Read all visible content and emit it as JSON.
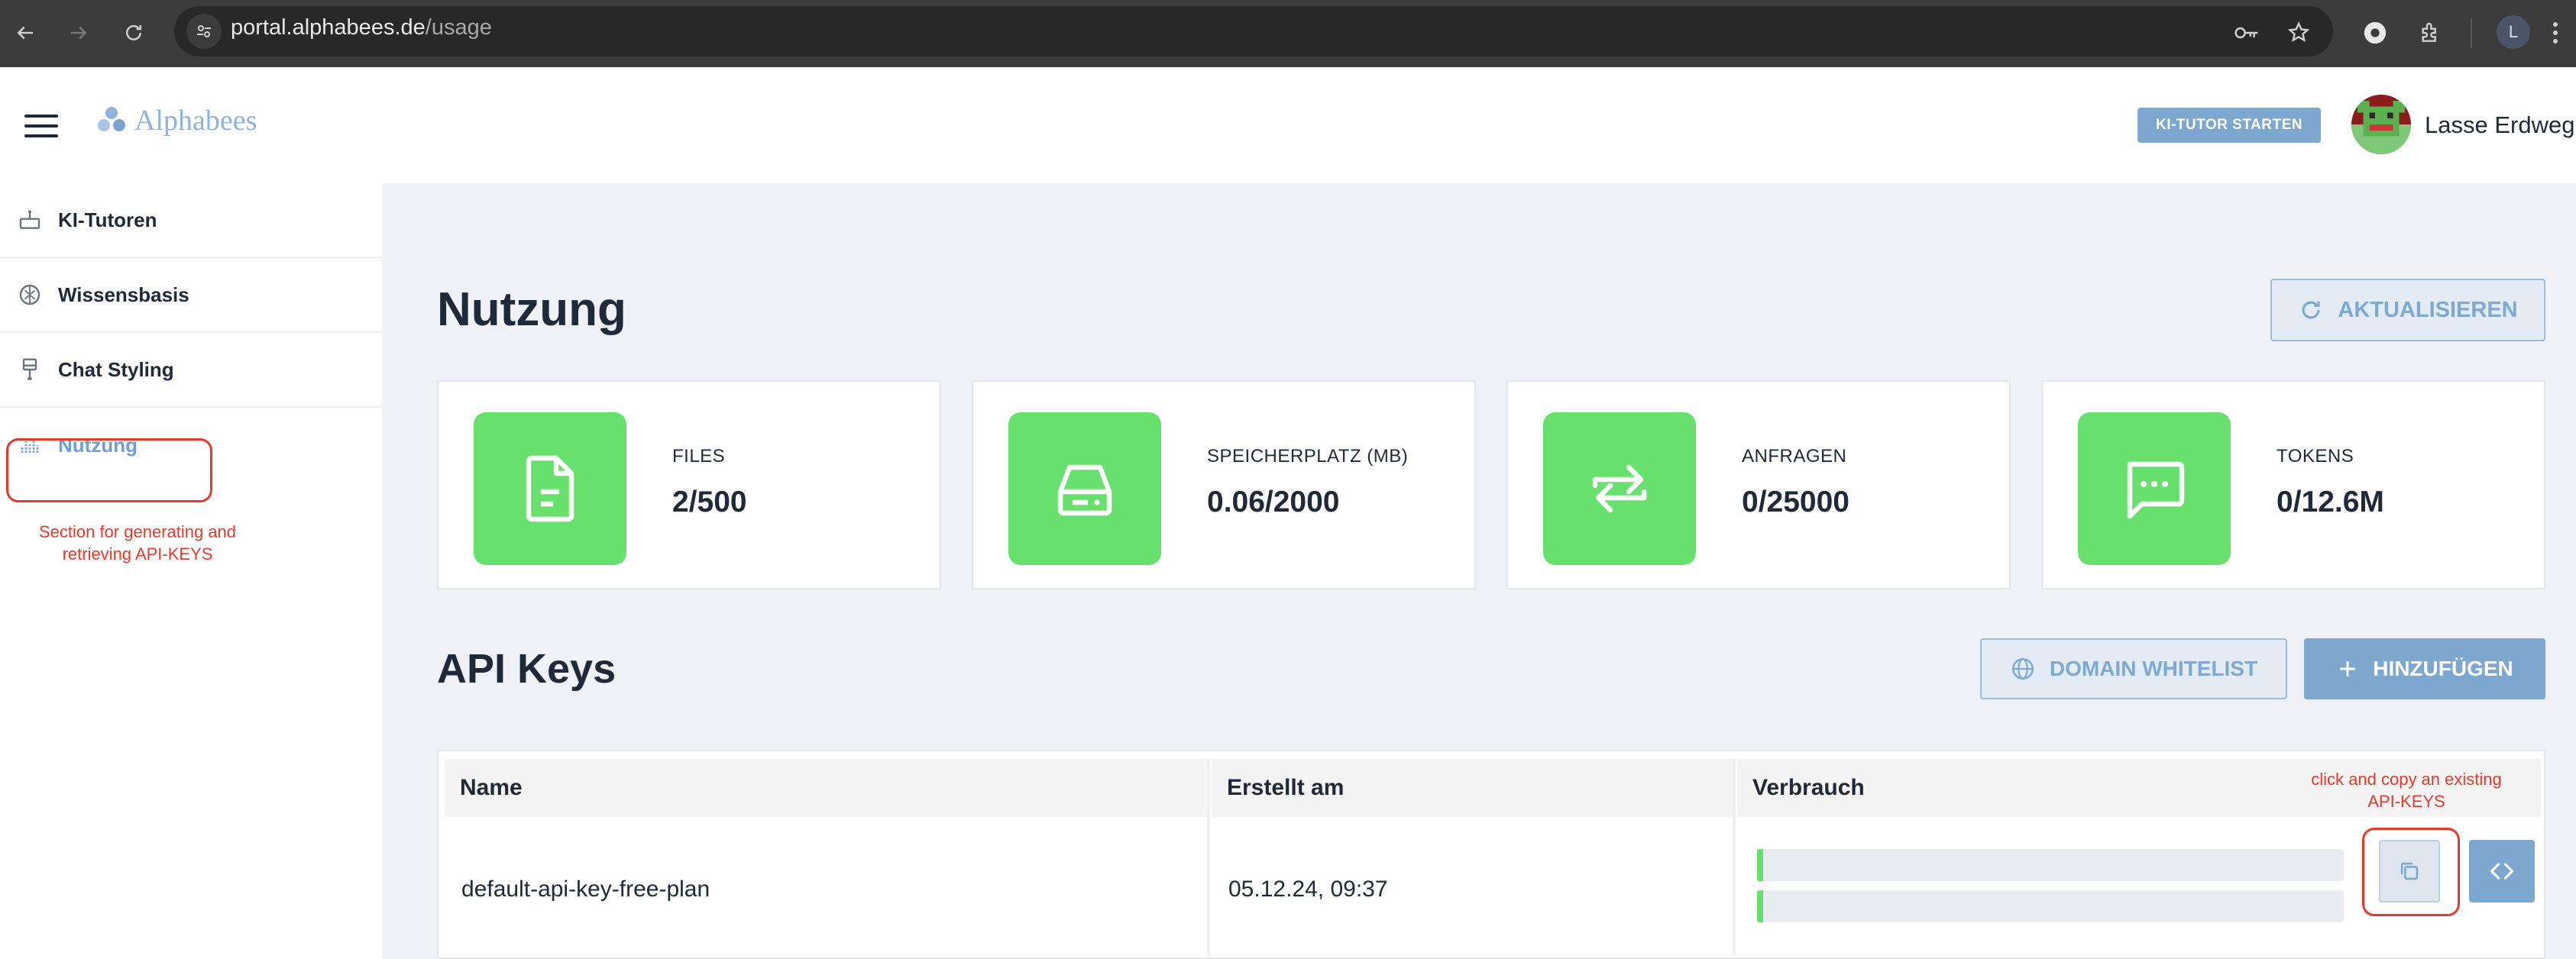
{
  "browser": {
    "url_host": "portal.alphabees.de",
    "url_path": "/usage",
    "profile_initial": "L"
  },
  "header": {
    "logo_text": "Alphabees",
    "tutor_button": "KI-TUTOR STARTEN",
    "user_name": "Lasse Erdweg"
  },
  "sidebar": {
    "items": [
      {
        "label": "KI-Tutoren",
        "icon": "robot-icon"
      },
      {
        "label": "Wissensbasis",
        "icon": "brain-icon"
      },
      {
        "label": "Chat Styling",
        "icon": "brush-icon"
      },
      {
        "label": "Nutzung",
        "icon": "chart-icon",
        "active": true
      }
    ],
    "annotation": "Section for generating and retrieving API-KEYS"
  },
  "main": {
    "title": "Nutzung",
    "refresh_button": "AKTUALISIEREN",
    "stats": [
      {
        "label": "FILES",
        "value": "2/500",
        "icon": "file-icon"
      },
      {
        "label": "SPEICHERPLATZ (MB)",
        "value": "0.06/2000",
        "icon": "storage-icon"
      },
      {
        "label": "ANFRAGEN",
        "value": "0/25000",
        "icon": "repeat-icon"
      },
      {
        "label": "TOKENS",
        "value": "0/12.6M",
        "icon": "chat-icon"
      }
    ],
    "api_section_title": "API Keys",
    "whitelist_button": "DOMAIN WHITELIST",
    "add_button": "HINZUFÜGEN",
    "table": {
      "headers": [
        "Name",
        "Erstellt am",
        "Verbrauch"
      ],
      "rows": [
        {
          "name": "default-api-key-free-plan",
          "created": "05.12.24, 09:37",
          "usage_fraction": [
            0.0,
            0.0
          ]
        }
      ]
    },
    "copy_annotation": "click and copy an existing API-KEYS"
  },
  "colors": {
    "accent": "#7da7cf",
    "stat_icon_bg": "#68e06d",
    "annotation": "#e23b2e",
    "content_bg": "#eef2f7"
  }
}
